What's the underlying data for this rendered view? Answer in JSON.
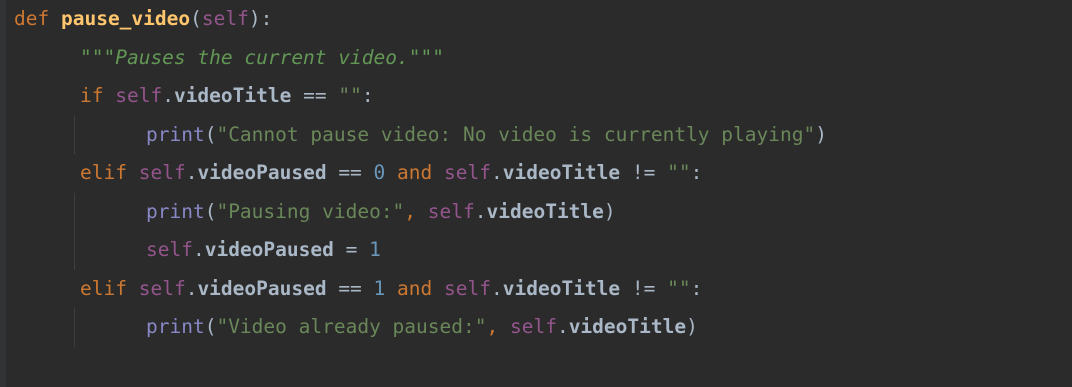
{
  "editor": {
    "language": "python",
    "lines": [
      {
        "indent": 0,
        "tokens": [
          {
            "type": "kw",
            "text": "def"
          },
          {
            "type": "op",
            "text": " "
          },
          {
            "type": "fn",
            "text": "pause_video"
          },
          {
            "type": "op",
            "text": "("
          },
          {
            "type": "self",
            "text": "self"
          },
          {
            "type": "op",
            "text": "):"
          }
        ]
      },
      {
        "indent": 1,
        "tokens": [
          {
            "type": "doc",
            "text": "\"\"\"Pauses the current video.\"\"\""
          }
        ]
      },
      {
        "indent": 1,
        "tokens": [
          {
            "type": "kw",
            "text": "if"
          },
          {
            "type": "op",
            "text": " "
          },
          {
            "type": "self",
            "text": "self"
          },
          {
            "type": "op",
            "text": "."
          },
          {
            "type": "attr",
            "text": "videoTitle"
          },
          {
            "type": "op",
            "text": " == "
          },
          {
            "type": "str",
            "text": "\"\""
          },
          {
            "type": "op",
            "text": ":"
          }
        ]
      },
      {
        "indent": 2,
        "tokens": [
          {
            "type": "call",
            "text": "print"
          },
          {
            "type": "op",
            "text": "("
          },
          {
            "type": "str",
            "text": "\"Cannot pause video: No video is currently playing\""
          },
          {
            "type": "op",
            "text": ")"
          }
        ]
      },
      {
        "indent": 1,
        "tokens": [
          {
            "type": "kw",
            "text": "elif"
          },
          {
            "type": "op",
            "text": " "
          },
          {
            "type": "self",
            "text": "self"
          },
          {
            "type": "op",
            "text": "."
          },
          {
            "type": "attr",
            "text": "videoPaused"
          },
          {
            "type": "op",
            "text": " == "
          },
          {
            "type": "num",
            "text": "0"
          },
          {
            "type": "op",
            "text": " "
          },
          {
            "type": "kw",
            "text": "and"
          },
          {
            "type": "op",
            "text": " "
          },
          {
            "type": "self",
            "text": "self"
          },
          {
            "type": "op",
            "text": "."
          },
          {
            "type": "attr",
            "text": "videoTitle"
          },
          {
            "type": "op",
            "text": " != "
          },
          {
            "type": "str",
            "text": "\"\""
          },
          {
            "type": "op",
            "text": ":"
          }
        ]
      },
      {
        "indent": 2,
        "tokens": [
          {
            "type": "call",
            "text": "print"
          },
          {
            "type": "op",
            "text": "("
          },
          {
            "type": "str",
            "text": "\"Pausing video:\""
          },
          {
            "type": "kw",
            "text": ", "
          },
          {
            "type": "self",
            "text": "self"
          },
          {
            "type": "op",
            "text": "."
          },
          {
            "type": "attr",
            "text": "videoTitle"
          },
          {
            "type": "op",
            "text": ")"
          }
        ]
      },
      {
        "indent": 2,
        "tokens": [
          {
            "type": "self",
            "text": "self"
          },
          {
            "type": "op",
            "text": "."
          },
          {
            "type": "attr",
            "text": "videoPaused"
          },
          {
            "type": "op",
            "text": " = "
          },
          {
            "type": "num",
            "text": "1"
          }
        ]
      },
      {
        "indent": 1,
        "tokens": [
          {
            "type": "kw",
            "text": "elif"
          },
          {
            "type": "op",
            "text": " "
          },
          {
            "type": "self",
            "text": "self"
          },
          {
            "type": "op",
            "text": "."
          },
          {
            "type": "attr",
            "text": "videoPaused"
          },
          {
            "type": "op",
            "text": " == "
          },
          {
            "type": "num",
            "text": "1"
          },
          {
            "type": "op",
            "text": " "
          },
          {
            "type": "kw",
            "text": "and"
          },
          {
            "type": "op",
            "text": " "
          },
          {
            "type": "self",
            "text": "self"
          },
          {
            "type": "op",
            "text": "."
          },
          {
            "type": "attr",
            "text": "videoTitle"
          },
          {
            "type": "op",
            "text": " != "
          },
          {
            "type": "str",
            "text": "\"\""
          },
          {
            "type": "op",
            "text": ":"
          }
        ]
      },
      {
        "indent": 2,
        "tokens": [
          {
            "type": "call",
            "text": "print"
          },
          {
            "type": "op",
            "text": "("
          },
          {
            "type": "str",
            "text": "\"Video already paused:\""
          },
          {
            "type": "kw",
            "text": ", "
          },
          {
            "type": "self",
            "text": "self"
          },
          {
            "type": "op",
            "text": "."
          },
          {
            "type": "attr",
            "text": "videoTitle"
          },
          {
            "type": "op",
            "text": ")"
          }
        ]
      }
    ]
  },
  "colors": {
    "background": "#2b2b2b",
    "keyword": "#cc7832",
    "function_name": "#ffc66d",
    "self": "#94558d",
    "string": "#6a8759",
    "docstring": "#629755",
    "number": "#6897bb",
    "builtin": "#8888c6",
    "identifier": "#a9b7c6"
  }
}
